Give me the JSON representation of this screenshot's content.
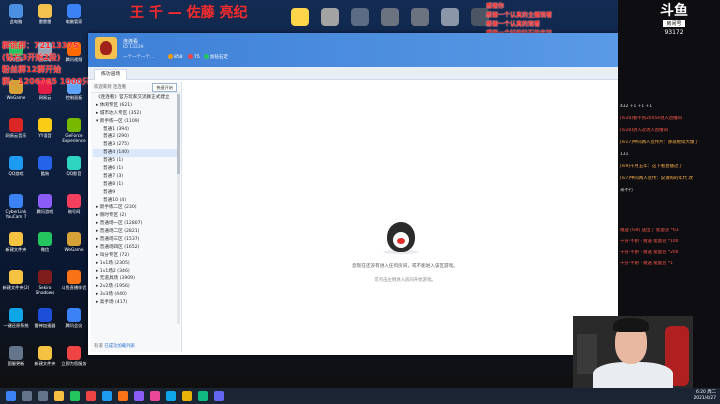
{
  "overlay": {
    "title_top": "王 千 — 佐藤 亮纪",
    "left_lines": [
      "群链群：72113375",
      "(钻石3开始2段)",
      "粉丝群12群开始",
      "群：1206785 1000只"
    ],
    "right_lines": [
      "感谢你",
      "感谢一个认真的主播观看",
      "感谢一个认真的观看",
      "感谢一个好的钻石的支持"
    ]
  },
  "desktop_icons": [
    {
      "label": "此电脑",
      "color": "#4a8fe0"
    },
    {
      "label": "雷雷雷",
      "color": "#f2c14e"
    },
    {
      "label": "电脑管家",
      "color": "#3b82f6"
    },
    {
      "label": "QQ音乐",
      "color": "#22c55e"
    },
    {
      "label": "回收站",
      "color": "#9aa6b8"
    },
    {
      "label": "腾讯视频",
      "color": "#ff6a00"
    },
    {
      "label": "WeGame",
      "color": "#d6a237"
    },
    {
      "label": "网易云",
      "color": "#e11d48"
    },
    {
      "label": "控制面板",
      "color": "#60a5fa"
    },
    {
      "label": "网易云音乐",
      "color": "#dc2626"
    },
    {
      "label": "YY语音",
      "color": "#facc15"
    },
    {
      "label": "GeForce Experience",
      "color": "#76b900"
    },
    {
      "label": "QQ游戏",
      "color": "#1d9bf0"
    },
    {
      "label": "酷狗",
      "color": "#2563eb"
    },
    {
      "label": "QQ影音",
      "color": "#2dd4bf"
    },
    {
      "label": "CyberLink YouCam 7",
      "color": "#3b82f6"
    },
    {
      "label": "腾讯游戏",
      "color": "#8b5cf6"
    },
    {
      "label": "暗号网",
      "color": "#f43f5e"
    },
    {
      "label": "新建文件夹",
      "color": "#f5c242"
    },
    {
      "label": "微信",
      "color": "#22c55e"
    },
    {
      "label": "WeGame",
      "color": "#d6a237"
    },
    {
      "label": "新建文件夹(2)",
      "color": "#f5c242"
    },
    {
      "label": "Sekiro Shadows",
      "color": "#7f1d1d"
    },
    {
      "label": "斗鱼直播伴侣",
      "color": "#f97316"
    },
    {
      "label": "一键还原系统",
      "color": "#0ea5e9"
    },
    {
      "label": "雷神加速器",
      "color": "#1d4ed8"
    },
    {
      "label": "腾讯会议",
      "color": "#3b82f6"
    },
    {
      "label": "国服更新",
      "color": "#64748b"
    },
    {
      "label": "新建文件夹",
      "color": "#f5c242"
    },
    {
      "label": "立即为您服务",
      "color": "#ef4444"
    }
  ],
  "window": {
    "user_name": "连连看",
    "user_id": "ID 13239",
    "user_status": "一个一个一个...",
    "badges": [
      {
        "label": "858",
        "color": "#f59e0b"
      },
      {
        "label": "75",
        "color": "#ef4444"
      },
      {
        "label": "加钻石定",
        "color": "#22c55e"
      }
    ],
    "tab_label": "练功道场",
    "left_header": "欢迎来到 连连看",
    "start_button": "快速开始",
    "tree": [
      {
        "label": "《连连看》官方玩家交流群正式建立",
        "level": 1
      },
      {
        "label": "▸ 休闲专区 (621)",
        "level": 1
      },
      {
        "label": "▸ 城市达人专区 (352)",
        "level": 1
      },
      {
        "label": "▾ 新手练一区 (1109)",
        "level": 1
      },
      {
        "label": "普通1 (394)",
        "level": 2
      },
      {
        "label": "普通2 (290)",
        "level": 2
      },
      {
        "label": "普通3 (275)",
        "level": 2
      },
      {
        "label": "普通4 (140)",
        "level": 2,
        "selected": true
      },
      {
        "label": "普通5 (1)",
        "level": 2
      },
      {
        "label": "普通6 (1)",
        "level": 2
      },
      {
        "label": "普通7 (3)",
        "level": 2
      },
      {
        "label": "普通8 (1)",
        "level": 2
      },
      {
        "label": "普通9",
        "level": 2
      },
      {
        "label": "普通10 (4)",
        "level": 2
      },
      {
        "label": "▸ 新手练二区 (230)",
        "level": 1
      },
      {
        "label": "▸ 限时专区 (2)",
        "level": 1
      },
      {
        "label": "▸ 普通场一区 (12807)",
        "level": 1
      },
      {
        "label": "▸ 普通场二区 (2821)",
        "level": 1
      },
      {
        "label": "▸ 普通场三区 (1537)",
        "level": 1
      },
      {
        "label": "▸ 普通场四区 (1652)",
        "level": 1
      },
      {
        "label": "▸ 叫分专区 (72)",
        "level": 1
      },
      {
        "label": "▸ 1v1场 (2305)",
        "level": 1
      },
      {
        "label": "▸ 1v1场2 (346)",
        "level": 1
      },
      {
        "label": "▸ 无道具场 (3909)",
        "level": 1
      },
      {
        "label": "▸ 2v2场 (1956)",
        "level": 1
      },
      {
        "label": "▸ 3v3场 (440)",
        "level": 1
      },
      {
        "label": "▸ 高手场 (417)",
        "level": 1
      }
    ],
    "left_footer_prefix": "有道 ",
    "left_footer_link": "已成功加载列表",
    "main_msg1": "您现在还没有进入任何房间，或不能进入该区游戏。",
    "main_msg2": "可点击左侧进入房间开始游戏。"
  },
  "stream": {
    "logo_top": "斗鱼",
    "logo_mid": "房间号",
    "room_number": "93172"
  },
  "chat": [
    {
      "text": "432 +1 +1 +1",
      "c": ""
    },
    {
      "text": "[lv28]看不到20454进入直播间",
      "c": "red"
    },
    {
      "text": "[lv28]进入过进入直播间",
      "c": "red"
    },
    {
      "text": "[lv17]中间两人宣传片：那就继续大爆了",
      "c": "orange"
    },
    {
      "text": "131",
      "c": ""
    },
    {
      "text": "[lv9]十月五年：这下看直播过了",
      "c": "orange"
    },
    {
      "text": "[lv7]中间两人宣传：说请购的年代 改",
      "c": "orange"
    },
    {
      "text": "来不行",
      "c": ""
    },
    {
      "text": "赠送 [lv8] 送出了 能量豆 *63",
      "c": "red"
    },
    {
      "text": "千分·不耐 · 赠送 能量豆 *100",
      "c": "red"
    },
    {
      "text": "千分·不耐 · 赠送 能量豆 *200",
      "c": "red"
    },
    {
      "text": "千分·不耐 · 赠送 能量豆 *1",
      "c": "red"
    }
  ],
  "taskbar": {
    "time": "6:20 周二",
    "date": "2021/4/27"
  }
}
